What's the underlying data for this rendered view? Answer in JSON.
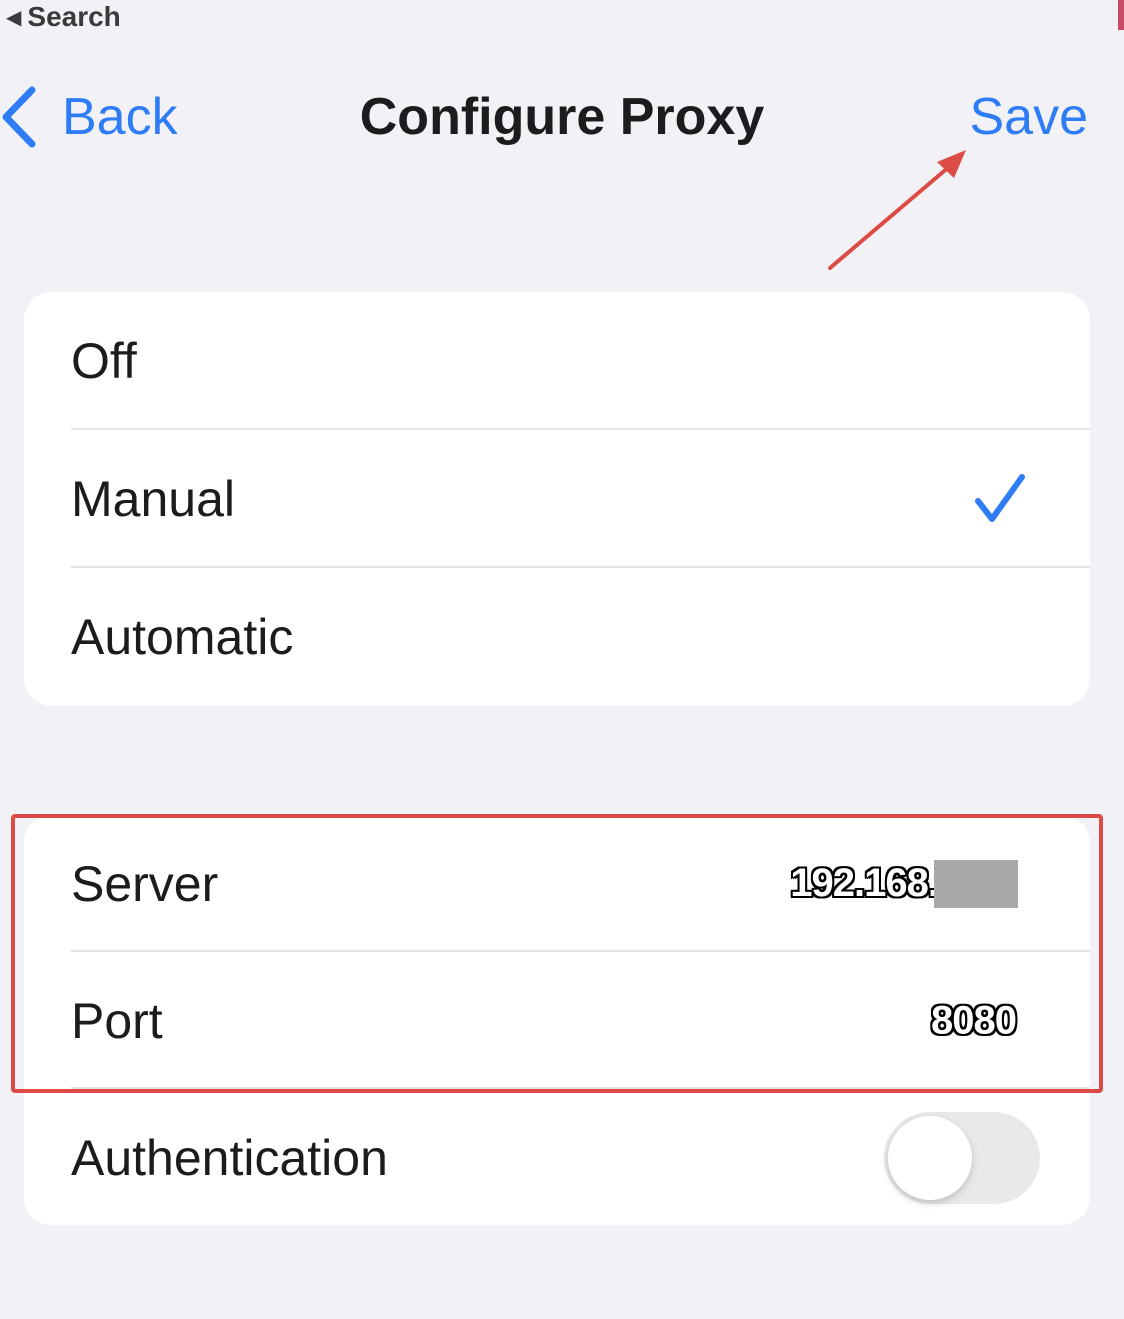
{
  "status_bar": {
    "back_glyph": "◀",
    "back_label": "Search"
  },
  "nav": {
    "back_label": "Back",
    "title": "Configure Proxy",
    "save_label": "Save"
  },
  "proxy_modes": {
    "selected": "Manual",
    "options": [
      {
        "label": "Off"
      },
      {
        "label": "Manual"
      },
      {
        "label": "Automatic"
      }
    ]
  },
  "settings": {
    "server": {
      "label": "Server",
      "value_visible": "192.168."
    },
    "port": {
      "label": "Port",
      "value": "8080"
    },
    "authentication": {
      "label": "Authentication",
      "enabled": false
    }
  },
  "colors": {
    "accent": "#2f7df6",
    "background": "#f2f2f6",
    "annotation": "#dc4b46"
  },
  "icons": {
    "back": "chevron-left-icon",
    "checkmark": "checkmark-icon"
  }
}
